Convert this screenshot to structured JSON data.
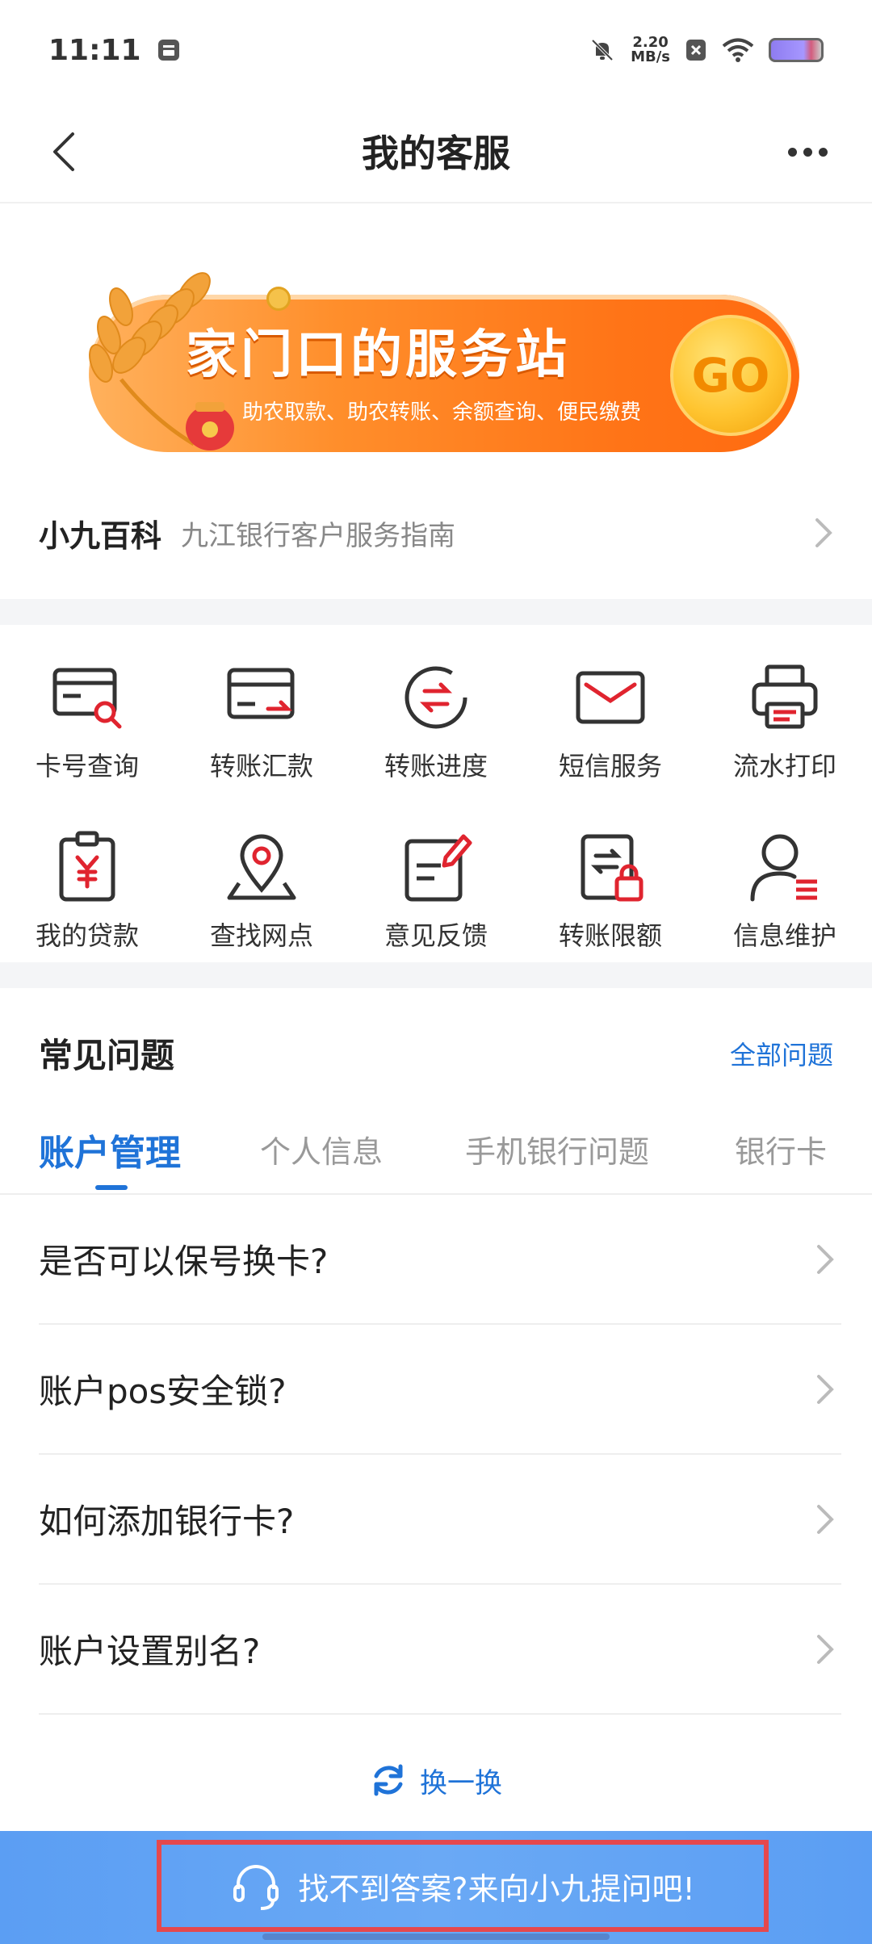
{
  "status": {
    "time": "11:11",
    "netspeed_value": "2.20",
    "netspeed_unit": "MB/s"
  },
  "nav": {
    "title": "我的客服"
  },
  "banner": {
    "title": "家门口的服务站",
    "subtitle": "助农取款、助农转账、余额查询、便民缴费",
    "go_label": "GO"
  },
  "wiki": {
    "title": "小九百科",
    "subtitle": "九江银行客户服务指南"
  },
  "services": [
    {
      "label": "卡号查询",
      "icon": "card-search-icon"
    },
    {
      "label": "转账汇款",
      "icon": "transfer-card-icon"
    },
    {
      "label": "转账进度",
      "icon": "transfer-progress-icon"
    },
    {
      "label": "短信服务",
      "icon": "envelope-icon"
    },
    {
      "label": "流水打印",
      "icon": "printer-icon"
    },
    {
      "label": "我的贷款",
      "icon": "loan-yen-icon"
    },
    {
      "label": "查找网点",
      "icon": "location-pin-icon"
    },
    {
      "label": "意见反馈",
      "icon": "feedback-edit-icon"
    },
    {
      "label": "转账限额",
      "icon": "transfer-lock-icon"
    },
    {
      "label": "信息维护",
      "icon": "user-info-icon"
    }
  ],
  "faq": {
    "title": "常见问题",
    "all_link": "全部问题",
    "tabs": [
      "账户管理",
      "个人信息",
      "手机银行问题",
      "银行卡"
    ],
    "active_tab": "账户管理",
    "items": [
      "是否可以保号换卡?",
      "账户pos安全锁?",
      "如何添加银行卡?",
      "账户设置别名?"
    ],
    "refresh_label": "换一换"
  },
  "bottom": {
    "ask_label": "找不到答案?来向小九提问吧!"
  },
  "colors": {
    "accent": "#1f73d8",
    "icon_red": "#e0242f",
    "bottom_bar": "#5b9ef3",
    "highlight": "#e5484d"
  }
}
